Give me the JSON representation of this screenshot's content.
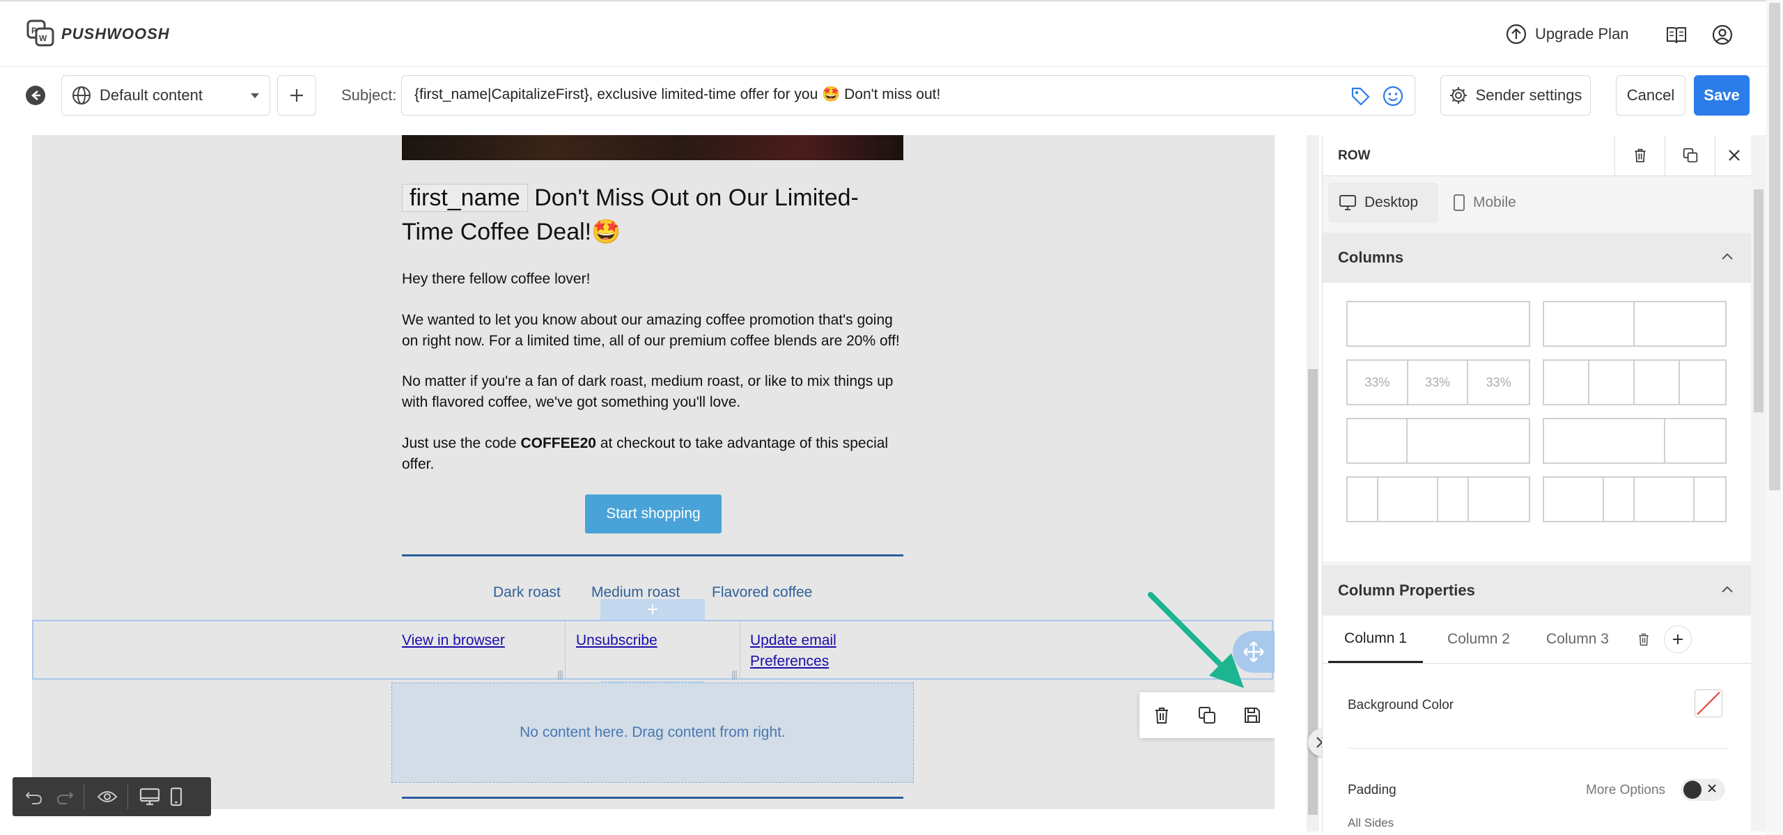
{
  "header": {
    "brand": "PUSHWOOSH",
    "upgrade_label": "Upgrade Plan"
  },
  "toolbar": {
    "content_select": "Default content",
    "subject_label": "Subject:",
    "subject_value": "{first_name|CapitalizeFirst}, exclusive limited-time offer for you 🤩 Don't miss out!",
    "sender_settings": "Sender settings",
    "cancel": "Cancel",
    "save": "Save"
  },
  "email": {
    "name_tag": "first_name",
    "headline": "Don't Miss Out on Our Limited-Time Coffee Deal!🤩",
    "greeting": "Hey there fellow coffee lover!",
    "p1": "We wanted to let you know about our amazing coffee promotion that's going on right now. For a limited time, all of our premium coffee blends are 20% off!",
    "p2": "No matter if you're a fan of dark roast, medium roast, or like to mix things up with flavored coffee, we've got something you'll love.",
    "p3_pre": "Just use the code ",
    "p3_code": "COFFEE20",
    "p3_post": " at checkout to take advantage of this special offer.",
    "cta": "Start shopping",
    "nav": [
      "Dark roast",
      "Medium roast",
      "Flavored coffee"
    ],
    "footer_links": [
      "View in browser",
      "Unsubscribe",
      "Update email Preferences"
    ],
    "empty_row": "No content here. Drag content from right."
  },
  "panel": {
    "title": "ROW",
    "view_tabs": [
      "Desktop",
      "Mobile"
    ],
    "columns_title": "Columns",
    "thirds": [
      "33%",
      "33%",
      "33%"
    ],
    "column_props_title": "Column Properties",
    "column_tabs": [
      "Column 1",
      "Column 2",
      "Column 3"
    ],
    "bg_color_label": "Background Color",
    "padding_label": "Padding",
    "more_options": "More Options",
    "all_sides": "All Sides"
  },
  "colors": {
    "accent": "#2b7de9",
    "cta": "#4aa3d8",
    "selection": "#a8c8ec",
    "arrow": "#1db58f"
  }
}
